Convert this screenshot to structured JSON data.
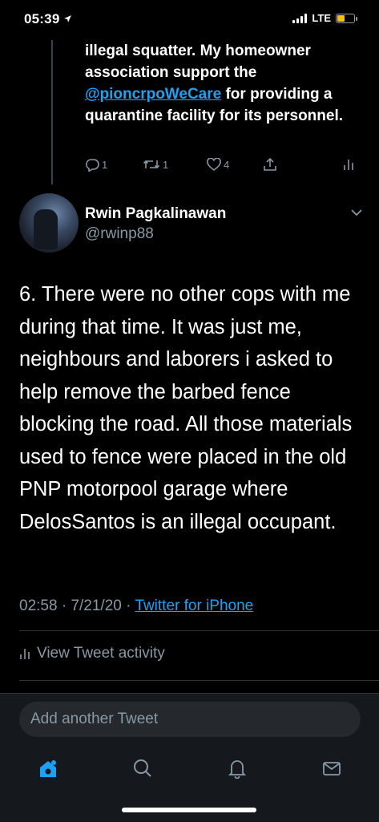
{
  "status_bar": {
    "time": "05:39",
    "network": "LTE",
    "battery_level": 0.45
  },
  "previous_tweet": {
    "text_before_mention": "illegal squatter. My homeowner association support the ",
    "mention": "@pioncrpoWeCare",
    "text_after_mention": " for providing a quarantine facility for its personnel.",
    "reply_count": "1",
    "retweet_count": "1",
    "like_count": "4"
  },
  "tweet": {
    "author_name": "Rwin Pagkalinawan",
    "author_handle": "@rwinp88",
    "text": "6. There were no other cops with me during that time. It was just me, neighbours and laborers i asked to help remove  the barbed fence blocking the road. All those materials used to fence were placed in the old PNP motorpool garage where DelosSantos is an illegal occupant.",
    "time": "02:58",
    "date": "7/21/20",
    "source": "Twitter for iPhone",
    "separator": " · "
  },
  "activity_label": "View Tweet activity",
  "compose": {
    "placeholder": "Add another Tweet"
  },
  "colors": {
    "accent": "#1da1f2",
    "muted": "#8899a6",
    "background": "#000000"
  },
  "icons": [
    "reply-icon",
    "retweet-icon",
    "like-icon",
    "share-icon",
    "analytics-icon",
    "chevron-down-icon",
    "home-icon",
    "search-icon",
    "notifications-icon",
    "messages-icon"
  ]
}
